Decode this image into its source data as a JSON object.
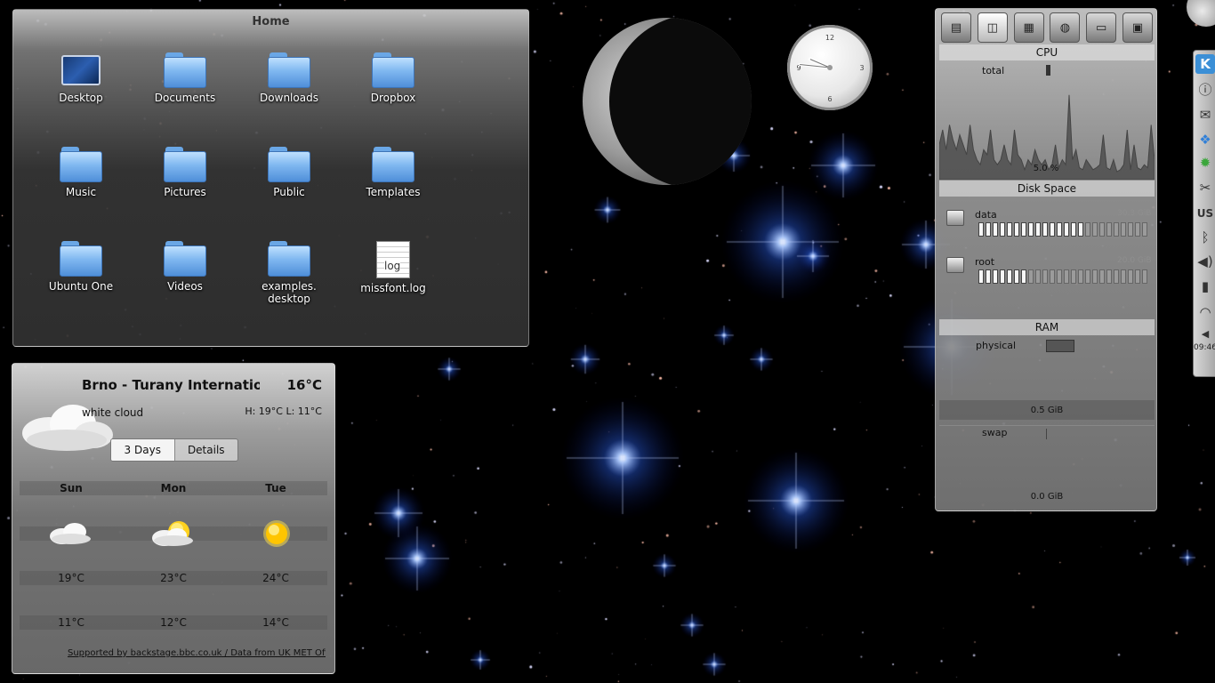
{
  "folderview": {
    "title": "Home",
    "items": [
      {
        "label": "Desktop",
        "icon": "desktop-icon"
      },
      {
        "label": "Documents",
        "icon": "folder-icon"
      },
      {
        "label": "Downloads",
        "icon": "folder-icon"
      },
      {
        "label": "Dropbox",
        "icon": "folder-icon"
      },
      {
        "label": "Music",
        "icon": "folder-icon"
      },
      {
        "label": "Pictures",
        "icon": "folder-icon"
      },
      {
        "label": "Public",
        "icon": "folder-icon"
      },
      {
        "label": "Templates",
        "icon": "folder-icon"
      },
      {
        "label": "Ubuntu One",
        "icon": "folder-icon"
      },
      {
        "label": "Videos",
        "icon": "folder-icon"
      },
      {
        "label": "examples.\ndesktop",
        "icon": "folder-icon"
      },
      {
        "label": "missfont.log",
        "icon": "log-file-icon",
        "icon_text": "log"
      }
    ]
  },
  "weather": {
    "location": "Brno - Turany International",
    "temperature": "16°C",
    "condition": "white cloud",
    "hilo": "H: 19°C L: 11°C",
    "tabs": [
      "3 Days",
      "Details"
    ],
    "days": [
      {
        "name": "Sun",
        "icon": "cloud-icon",
        "high": "19°C",
        "low": "11°C"
      },
      {
        "name": "Mon",
        "icon": "sun-cloud-icon",
        "high": "23°C",
        "low": "12°C"
      },
      {
        "name": "Tue",
        "icon": "sun-icon",
        "high": "24°C",
        "low": "14°C"
      }
    ],
    "credit": "Supported by backstage.bbc.co.uk / Data from UK MET Office"
  },
  "clock": {
    "numerals": [
      "12",
      "3",
      "6",
      "9"
    ],
    "hour": 9,
    "minute": 46
  },
  "moon": {
    "phase": "waning crescent"
  },
  "sysmon": {
    "tabs": [
      "network-monitor-icon",
      "hard-disk-icon",
      "hardware-icon",
      "globe-icon",
      "display-icon",
      "cpu-chip-icon"
    ],
    "cpu": {
      "title": "CPU",
      "label": "total",
      "value": "5.0 %",
      "history": [
        0.35,
        0.5,
        0.3,
        0.55,
        0.4,
        0.3,
        0.45,
        0.35,
        0.25,
        0.55,
        0.3,
        0.2,
        0.15,
        0.3,
        0.25,
        0.5,
        0.2,
        0.15,
        0.2,
        0.35,
        0.2,
        0.15,
        0.5,
        0.25,
        0.2,
        0.1,
        0.2,
        0.15,
        0.3,
        0.2,
        0.15,
        0.2,
        0.1,
        0.15,
        0.35,
        0.12,
        0.2,
        0.15,
        0.85,
        0.2,
        0.3,
        0.12,
        0.1,
        0.2,
        0.15,
        0.1,
        0.12,
        0.15,
        0.45,
        0.12,
        0.1,
        0.2,
        0.08,
        0.1,
        0.15,
        0.5,
        0.1,
        0.35,
        0.12,
        0.1,
        0.15,
        0.12,
        0.55,
        0.2
      ]
    },
    "disk": {
      "title": "Disk Space",
      "disks": [
        {
          "name": "data",
          "size": "30.3 GiB",
          "used_fraction": 0.63
        },
        {
          "name": "root",
          "size": "20.0 GiB",
          "used_fraction": 0.3
        }
      ]
    },
    "ram": {
      "title": "RAM",
      "physical_label": "physical",
      "physical_value": "0.5 GiB",
      "swap_label": "swap",
      "swap_value": "0.0 GiB"
    }
  },
  "panel": {
    "icons": [
      "kde-launcher-icon",
      "info-icon",
      "mail-icon",
      "dropbox-icon",
      "updates-icon",
      "clipboard-scissors-icon",
      "keyboard-layout-icon",
      "bluetooth-icon",
      "volume-icon",
      "battery-icon",
      "wifi-icon",
      "collapse-arrow-icon"
    ],
    "keyboard_layout": "US",
    "time": "09:46"
  }
}
